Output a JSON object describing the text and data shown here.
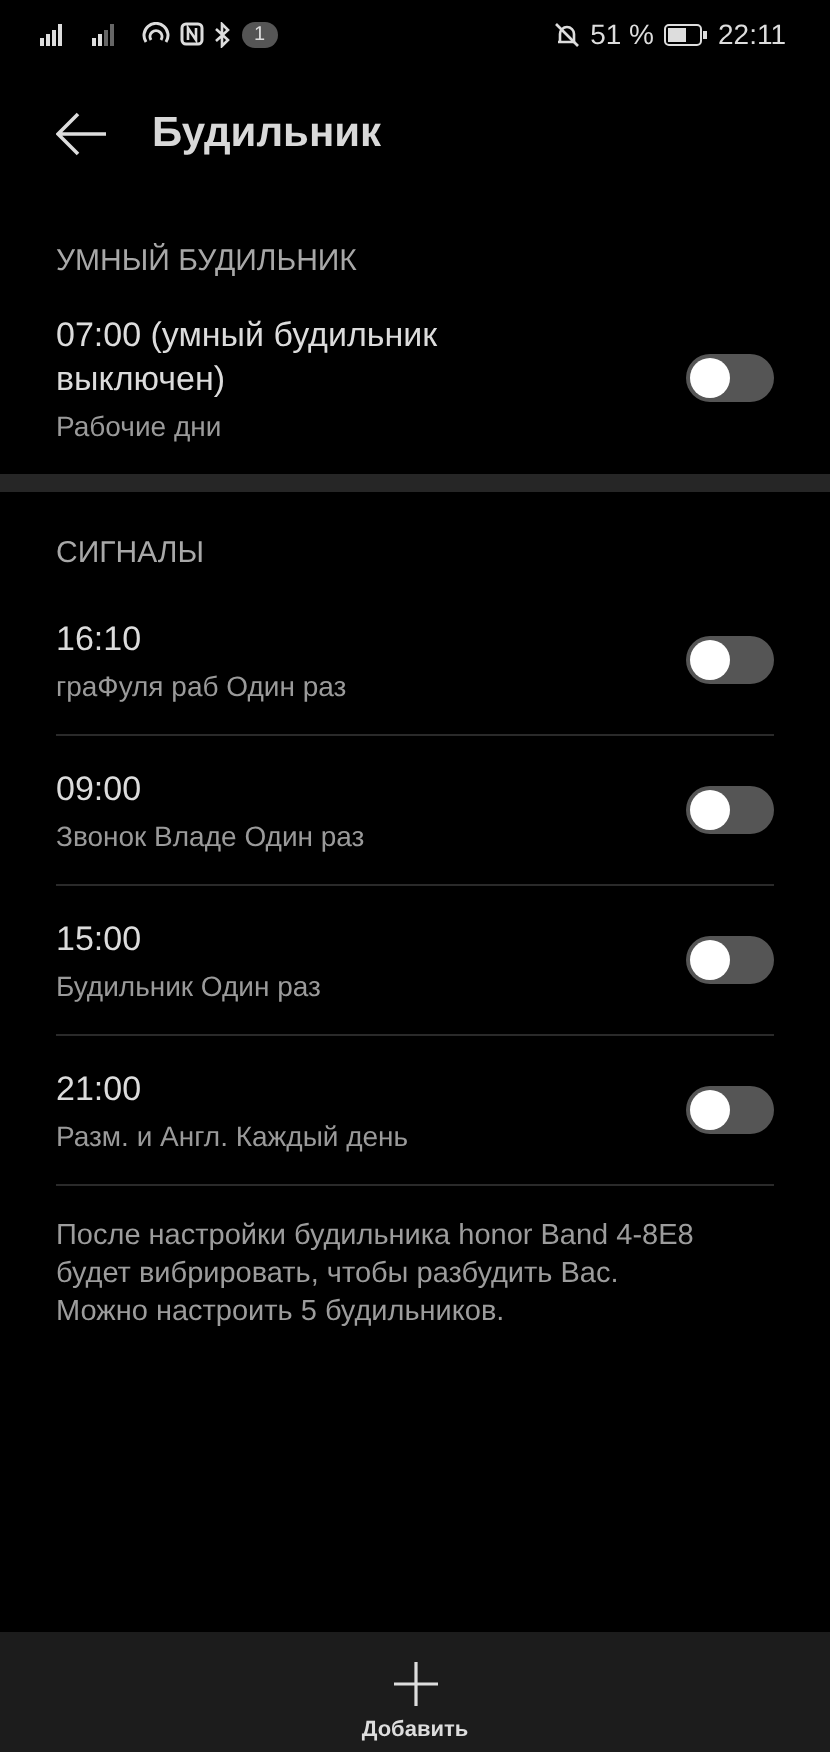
{
  "status_bar": {
    "notification_count": "1",
    "battery": "51 %",
    "time": "22:11"
  },
  "header": {
    "title": "Будильник"
  },
  "smart_section": {
    "title": "УМНЫЙ БУДИЛЬНИК",
    "alarm": {
      "time": "07:00 (умный будильник выключен)",
      "detail": "Рабочие дни",
      "on": false
    }
  },
  "signals_section": {
    "title": "СИГНАЛЫ",
    "alarms": [
      {
        "time": "16:10",
        "detail": "граФуля раб Один раз",
        "on": false
      },
      {
        "time": "09:00",
        "detail": "Звонок Владе Один раз",
        "on": false
      },
      {
        "time": "15:00",
        "detail": "Будильник Один раз",
        "on": false
      },
      {
        "time": "21:00",
        "detail": "Разм. и Англ. Каждый день",
        "on": false
      }
    ]
  },
  "note": "После настройки будильника honor Band 4-8E8 будет вибрировать, чтобы разбудить Вас. Можно настроить 5 будильников.",
  "bottom_bar": {
    "add_label": "Добавить"
  }
}
